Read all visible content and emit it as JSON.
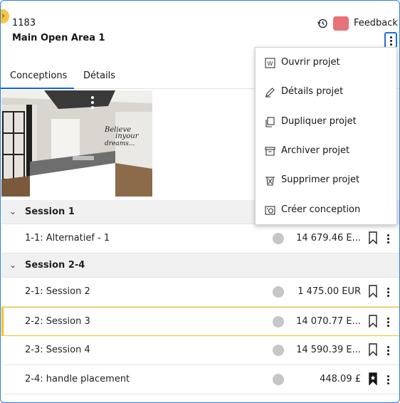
{
  "header": {
    "project_id": "1183",
    "project_name": "Main Open Area 1",
    "feedback_label": "Feedback",
    "swatch_color": "#e8727a"
  },
  "tabs": [
    {
      "label": "Conceptions",
      "active": true
    },
    {
      "label": "Détails",
      "active": false
    }
  ],
  "thumbnail": {
    "wall_text": "Believe in your dreams..."
  },
  "sessions": [
    {
      "label": "Session 1",
      "rows": [
        {
          "label": "1-1: Alternatief - 1",
          "price": "14 679.46 E...",
          "bookmarked": false,
          "selected": false
        }
      ]
    },
    {
      "label": "Session 2-4",
      "rows": [
        {
          "label": "2-1: Session 2",
          "price": "1 475.00 EUR",
          "bookmarked": false,
          "selected": false
        },
        {
          "label": "2-2: Session 3",
          "price": "14 070.77 E...",
          "bookmarked": false,
          "selected": true
        },
        {
          "label": "2-3: Session 4",
          "price": "14 590.39 E...",
          "bookmarked": false,
          "selected": false
        },
        {
          "label": "2-4: handle placement",
          "price": "448.09 £",
          "bookmarked": true,
          "selected": false
        }
      ]
    }
  ],
  "menu": {
    "items": [
      {
        "label": "Ouvrir projet",
        "icon": "open-word-icon"
      },
      {
        "label": "Détails projet",
        "icon": "pencil-icon"
      },
      {
        "label": "Dupliquer projet",
        "icon": "duplicate-icon"
      },
      {
        "label": "Archiver projet",
        "icon": "archive-icon"
      },
      {
        "label": "Supprimer projet",
        "icon": "trash-icon"
      },
      {
        "label": "Créer conception",
        "icon": "create-design-icon"
      }
    ]
  },
  "colors": {
    "accent": "#0f62fe",
    "selection": "#f1c21b",
    "focus": "#1a6fe0"
  }
}
